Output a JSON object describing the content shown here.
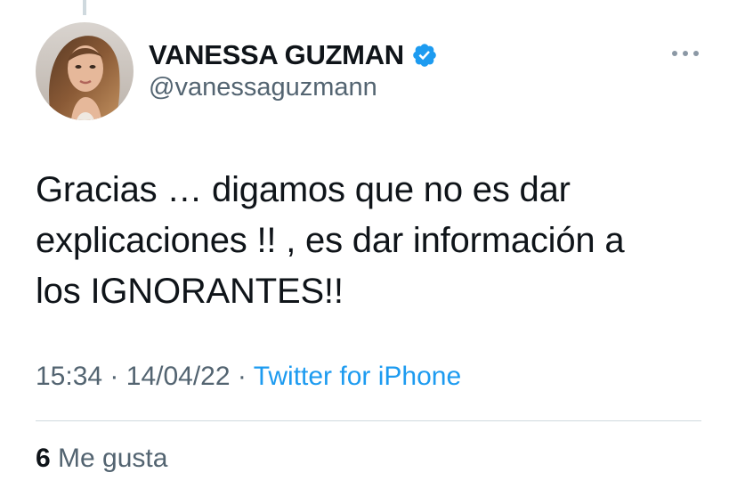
{
  "tweet": {
    "author": {
      "display_name": "VANESSA GUZMAN",
      "handle": "@vanessaguzmann",
      "verified": true,
      "avatar_icon": "profile-photo"
    },
    "text_lines": [
      "Gracias … digamos que no es dar",
      "explicaciones !! , es dar información a",
      "los IGNORANTES!!"
    ],
    "time": "15:34",
    "date": "14/04/22",
    "separator": "·",
    "source": "Twitter for iPhone",
    "likes": {
      "count": "6",
      "label": "Me gusta"
    },
    "more_icon": "more-horizontal-icon"
  },
  "colors": {
    "text_primary": "#0f1419",
    "text_secondary": "#536471",
    "link": "#1d9bf0",
    "verified": "#1d9bf0",
    "divider": "#cfd9de"
  }
}
